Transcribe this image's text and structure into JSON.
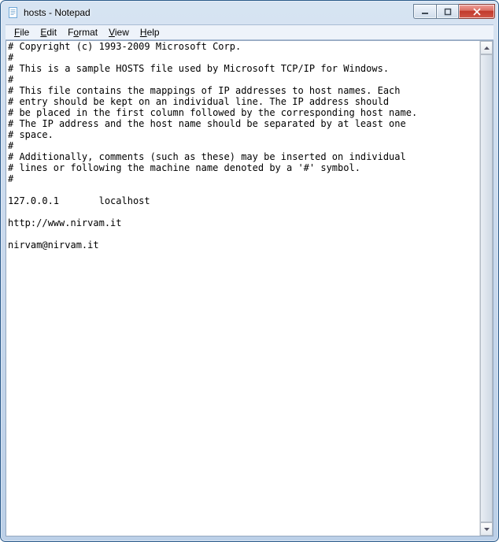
{
  "window": {
    "title": "hosts - Notepad"
  },
  "menu": {
    "file": "File",
    "edit": "Edit",
    "format": "Format",
    "view": "View",
    "help": "Help"
  },
  "icons": {
    "app": "notepad-icon",
    "min": "minimize-icon",
    "max": "maximize-icon",
    "close": "close-icon",
    "scroll_up": "scroll-up-icon",
    "scroll_down": "scroll-down-icon"
  },
  "document": {
    "content": "# Copyright (c) 1993-2009 Microsoft Corp.\n#\n# This is a sample HOSTS file used by Microsoft TCP/IP for Windows.\n#\n# This file contains the mappings of IP addresses to host names. Each\n# entry should be kept on an individual line. The IP address should\n# be placed in the first column followed by the corresponding host name.\n# The IP address and the host name should be separated by at least one\n# space.\n#\n# Additionally, comments (such as these) may be inserted on individual\n# lines or following the machine name denoted by a '#' symbol.\n#\n\n127.0.0.1       localhost\n\nhttp://www.nirvam.it\n\nnirvam@nirvam.it"
  }
}
